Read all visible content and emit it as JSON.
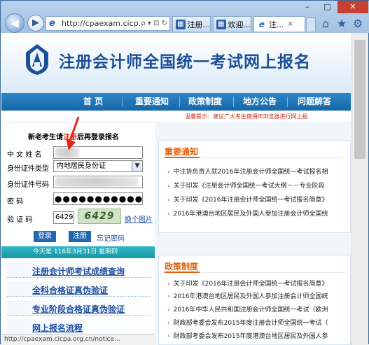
{
  "browser": {
    "window_controls": {
      "minimize": "–",
      "maximize": "□",
      "close": "✕"
    },
    "address": {
      "url": "http://cpaexam.cicp...",
      "controls": "ρ ▾ ⊡ ↻"
    },
    "tabs": [
      {
        "label": "注册...",
        "icon": "page-icon"
      },
      {
        "label": "欢迎...",
        "icon": "page-icon"
      },
      {
        "label": "注...",
        "icon": "ie-icon",
        "close": "×"
      }
    ],
    "toolbar_icons": [
      "home-icon",
      "star-icon",
      "gear-icon"
    ]
  },
  "site": {
    "title": "注册会计师全国统一考试网上报名",
    "menu": [
      "首 页",
      "重要通知",
      "政策制度",
      "地方公告",
      "问题解答"
    ],
    "notice": "温馨提示：建议广大考生使用IE浏览器进行网上报"
  },
  "login": {
    "heading_pre": "新老考生请",
    "heading_red": "注册",
    "heading_post": "后再登录报名",
    "labels": {
      "name": "中  文  姓  名",
      "id_type": "身份证件类型",
      "id_number": "身份证件号码",
      "password": "密          码",
      "captcha": "验    证    码"
    },
    "id_type_value": "内地居民身份证",
    "password_dots": "●●●●●●●●●●●",
    "captcha_input": "6429",
    "captcha_image_text": "6429",
    "change_image": "换个图片",
    "login_button": "登录",
    "register_button": "注册",
    "forgot": "忘记密码",
    "date": "今天是  116年3月31日  星期四"
  },
  "side_links": [
    "注册会计师考试成绩查询",
    "全科合格证真伪验证",
    "专业阶段合格证真伪验证",
    "网上报名流程"
  ],
  "status_bar": "http://cpaexam.cicpa.org.cn/notice...",
  "important": {
    "title": "重要通知",
    "items": [
      "中注协负责人就2016年注册会计师全国统一考试报名相",
      "关于印发《注册会计师全国统一考试大纲－－专业阶段",
      "关于印发《2016年注册会计师全国统一考试报名简章》",
      "2016年港澳台地区居民及外国人参加注册会计师全国统"
    ]
  },
  "policy": {
    "title": "政策制度",
    "items": [
      "关于印发《2016年注册会计师全国统一考试报名简章》",
      "2016年港澳台地区居民及外国人参加注册会计师全国统",
      "2016年中华人民共和国注册会计师全国统一考试（欧洲",
      "财政部考委会发布2015年度注册会计师全国统一考试（",
      "财政部考委会发布2015年度港澳台地区居民及外国人参"
    ]
  }
}
